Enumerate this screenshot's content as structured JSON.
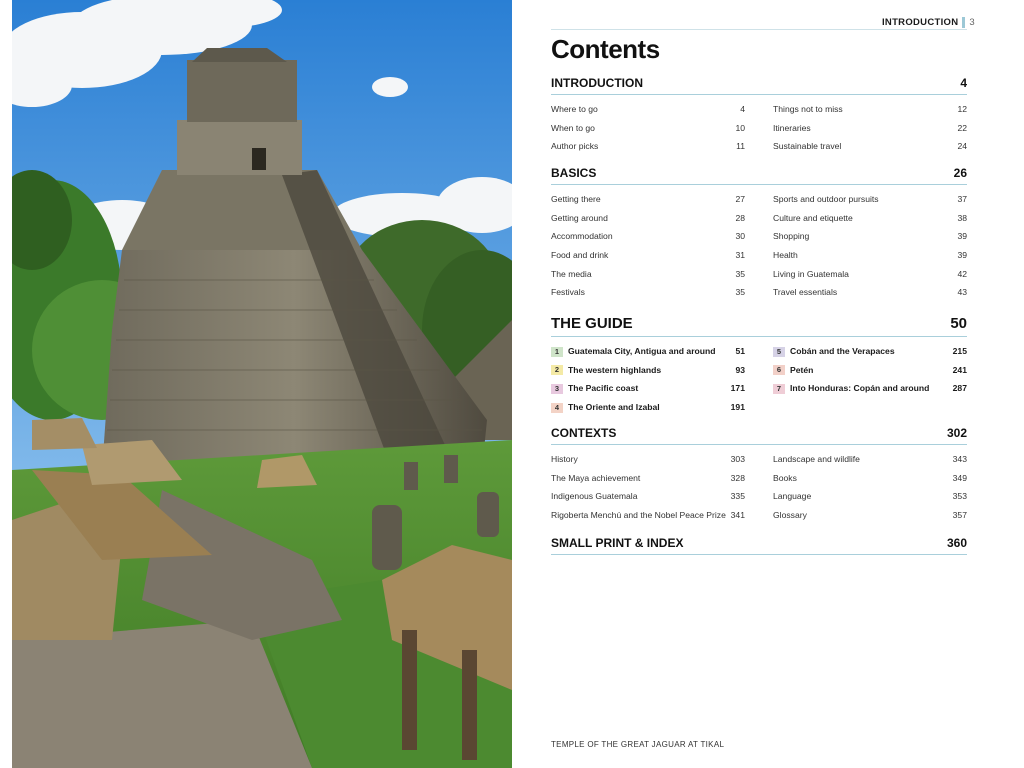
{
  "running_head": {
    "section": "INTRODUCTION",
    "page": "3"
  },
  "title": "Contents",
  "sections": [
    {
      "id": "introduction",
      "title": "INTRODUCTION",
      "page": "4",
      "left": [
        {
          "label": "Where to go",
          "page": "4"
        },
        {
          "label": "When to go",
          "page": "10"
        },
        {
          "label": "Author picks",
          "page": "11"
        }
      ],
      "right": [
        {
          "label": "Things not to miss",
          "page": "12"
        },
        {
          "label": "Itineraries",
          "page": "22"
        },
        {
          "label": "Sustainable travel",
          "page": "24"
        }
      ]
    },
    {
      "id": "basics",
      "title": "BASICS",
      "page": "26",
      "left": [
        {
          "label": "Getting there",
          "page": "27"
        },
        {
          "label": "Getting around",
          "page": "28"
        },
        {
          "label": "Accommodation",
          "page": "30"
        },
        {
          "label": "Food and drink",
          "page": "31"
        },
        {
          "label": "The media",
          "page": "35"
        },
        {
          "label": "Festivals",
          "page": "35"
        }
      ],
      "right": [
        {
          "label": "Sports and outdoor pursuits",
          "page": "37"
        },
        {
          "label": "Culture and etiquette",
          "page": "38"
        },
        {
          "label": "Shopping",
          "page": "39"
        },
        {
          "label": "Health",
          "page": "39"
        },
        {
          "label": "Living in Guatemala",
          "page": "42"
        },
        {
          "label": "Travel essentials",
          "page": "43"
        }
      ]
    },
    {
      "id": "guide",
      "title": "THE GUIDE",
      "page": "50",
      "left": [
        {
          "num": "1",
          "label": "Guatemala City, Antigua and around",
          "page": "51",
          "color": "#cfe4c9"
        },
        {
          "num": "2",
          "label": "The western highlands",
          "page": "93",
          "color": "#f4eaa6"
        },
        {
          "num": "3",
          "label": "The Pacific coast",
          "page": "171",
          "color": "#e8c9df"
        },
        {
          "num": "4",
          "label": "The Oriente and Izabal",
          "page": "191",
          "color": "#f3d3c6"
        }
      ],
      "right": [
        {
          "num": "5",
          "label": "Cobán and the Verapaces",
          "page": "215",
          "color": "#d6d2e6"
        },
        {
          "num": "6",
          "label": "Petén",
          "page": "241",
          "color": "#f2d0c8"
        },
        {
          "num": "7",
          "label": "Into Honduras: Copán and around",
          "page": "287",
          "color": "#efcdd6"
        }
      ]
    },
    {
      "id": "contexts",
      "title": "CONTEXTS",
      "page": "302",
      "left": [
        {
          "label": "History",
          "page": "303"
        },
        {
          "label": "The Maya achievement",
          "page": "328"
        },
        {
          "label": "Indigenous Guatemala",
          "page": "335"
        },
        {
          "label": "Rigoberta Menchú and the Nobel Peace Prize",
          "page": "341"
        }
      ],
      "right": [
        {
          "label": "Landscape and wildlife",
          "page": "343"
        },
        {
          "label": "Books",
          "page": "349"
        },
        {
          "label": "Language",
          "page": "353"
        },
        {
          "label": "Glossary",
          "page": "357"
        }
      ]
    },
    {
      "id": "smallprint",
      "title": "SMALL PRINT & INDEX",
      "page": "360",
      "left": [],
      "right": []
    }
  ],
  "caption": "TEMPLE OF THE GREAT JAGUAR AT TIKAL"
}
